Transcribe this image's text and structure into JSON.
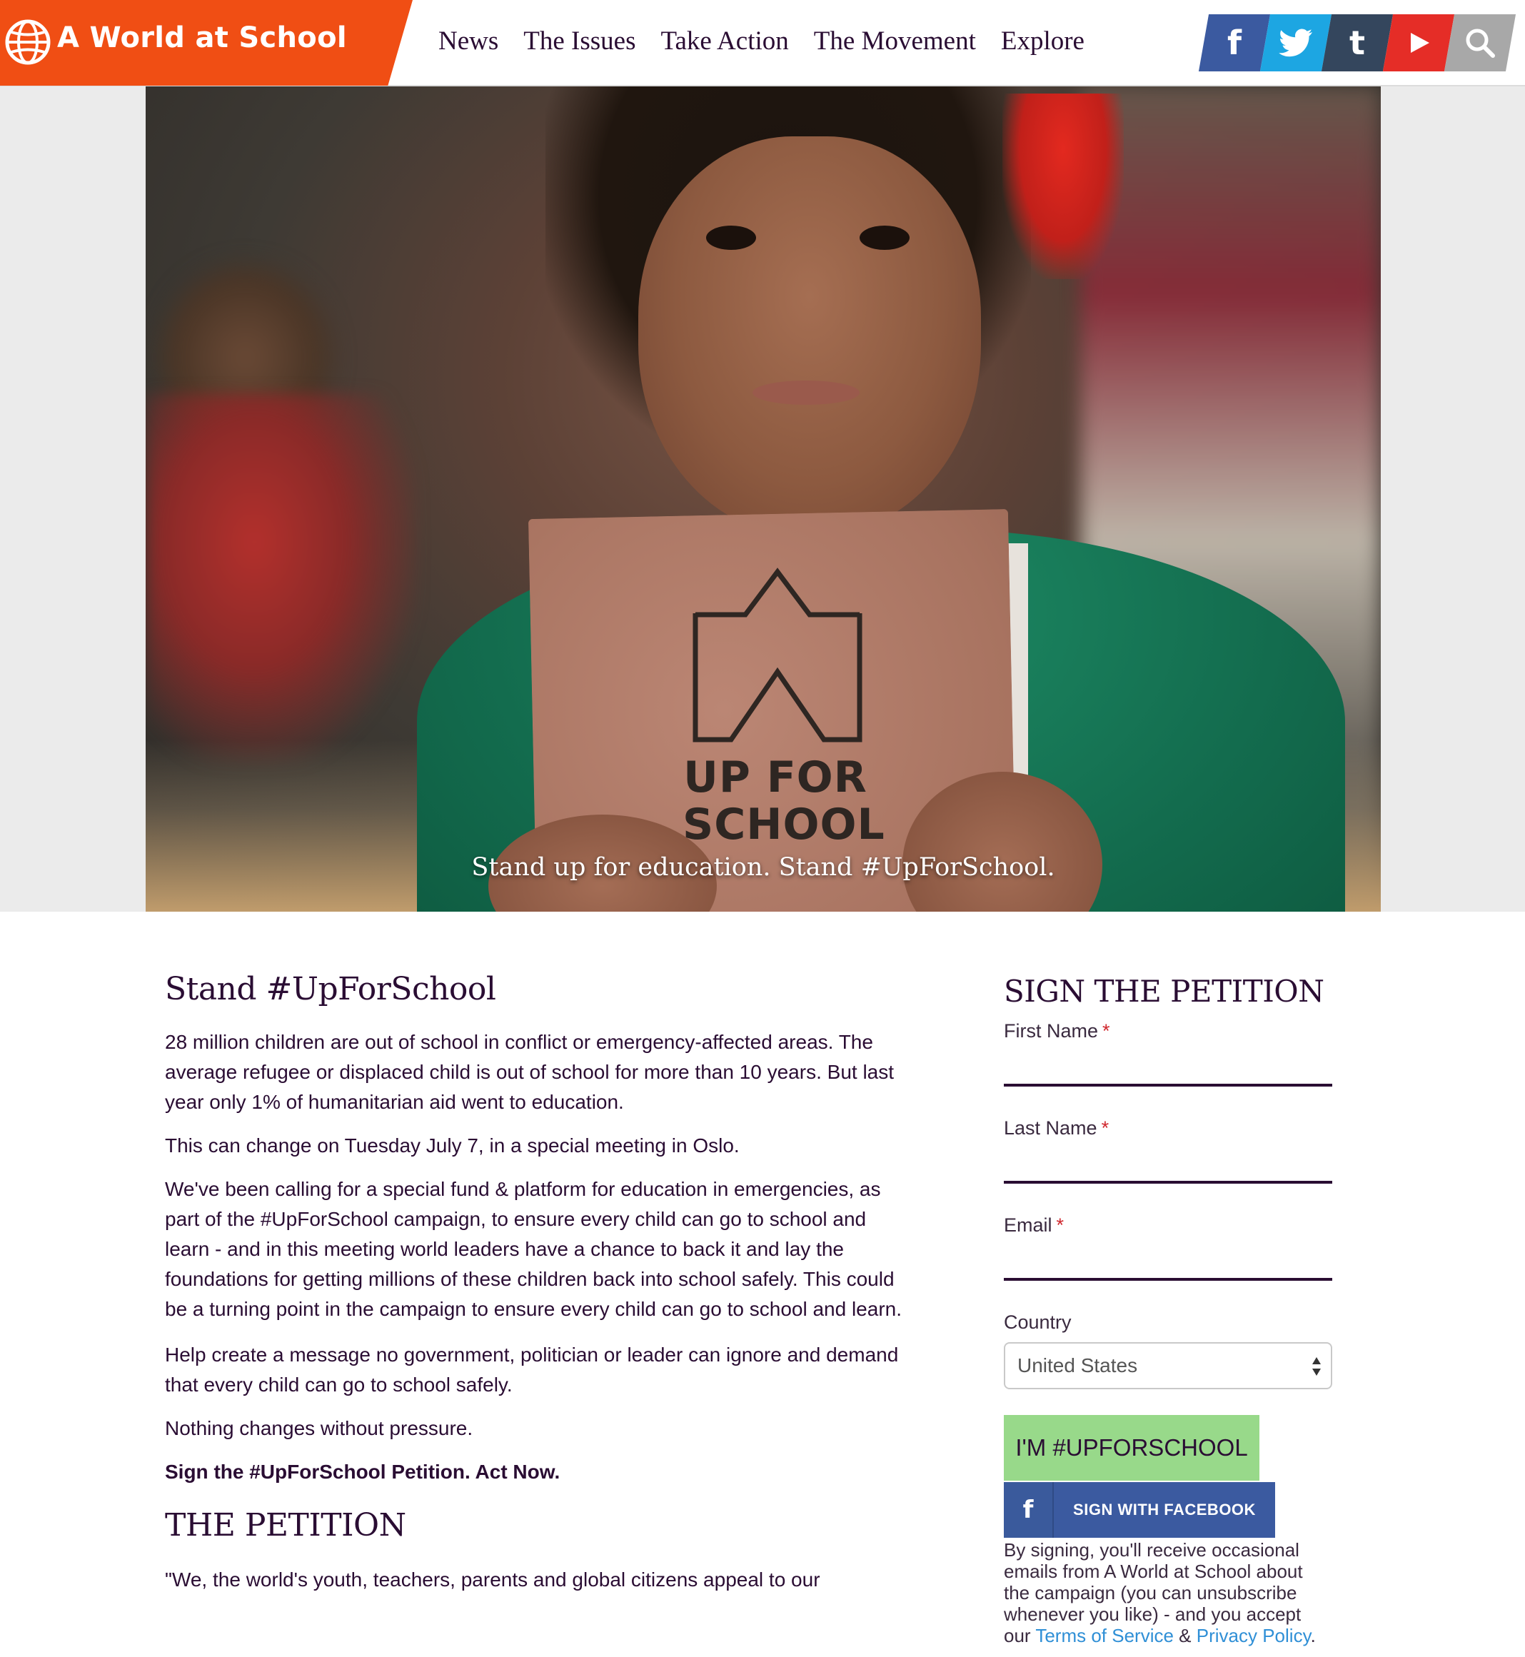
{
  "brand": {
    "name": "A World at School",
    "color": "#f04e14"
  },
  "nav": {
    "items": [
      "News",
      "The Issues",
      "Take Action",
      "The Movement",
      "Explore"
    ]
  },
  "social": [
    {
      "icon": "facebook-icon",
      "glyph": "f",
      "color": "#3b5aa0"
    },
    {
      "icon": "twitter-icon",
      "glyph": "",
      "color": "#1da6e2"
    },
    {
      "icon": "tumblr-icon",
      "glyph": "t",
      "color": "#34465d"
    },
    {
      "icon": "youtube-icon",
      "glyph": "",
      "color": "#e52d27"
    },
    {
      "icon": "search-icon",
      "glyph": "",
      "color": "#a8a8a8"
    }
  ],
  "hero": {
    "book_text_line1": "UP FOR",
    "book_text_line2": "SCHOOL",
    "caption": "Stand up for education. Stand #UpForSchool."
  },
  "main": {
    "heading": "Stand #UpForSchool",
    "paragraphs": [
      "28 million children are out of school in conflict or emergency-affected areas. The average refugee or displaced child is out of school for more than 10 years. But last year only 1% of humanitarian aid went to education.",
      "This can change on Tuesday July 7, in a special meeting in Oslo.",
      "We've been calling for a special fund & platform for education in emergencies, as part of the #UpForSchool campaign, to ensure every child can go to school and learn - and in this meeting world leaders have a chance to back it and lay the foundations for getting millions of these children back into school safely. This could be a turning point in the campaign to ensure every child can go to school and learn.",
      "Help create a message no government, politician or leader can ignore and demand that every child can go to school safely.",
      "Nothing changes without pressure.",
      "Sign the #UpForSchool Petition. Act Now."
    ],
    "petition_heading": "THE PETITION",
    "petition_text": "\"We, the world's youth, teachers, parents and global citizens appeal to our"
  },
  "form": {
    "heading": "SIGN THE PETITION",
    "first_name_label": "First Name",
    "last_name_label": "Last Name",
    "email_label": "Email",
    "required_mark": "*",
    "first_name_value": "",
    "last_name_value": "",
    "email_value": "",
    "country_label": "Country",
    "country_value": "United States",
    "submit_label": "I'M #UPFORSCHOOL",
    "facebook_label": "SIGN WITH FACEBOOK",
    "facebook_glyph": "f",
    "disclaimer_prefix": "By signing, you'll receive occasional emails from A World at School about the campaign (you can unsubscribe whenever you like) - and you accept our ",
    "terms_label": "Terms of Service",
    "amp": " & ",
    "privacy_label": "Privacy Policy",
    "disclaimer_suffix": "."
  }
}
